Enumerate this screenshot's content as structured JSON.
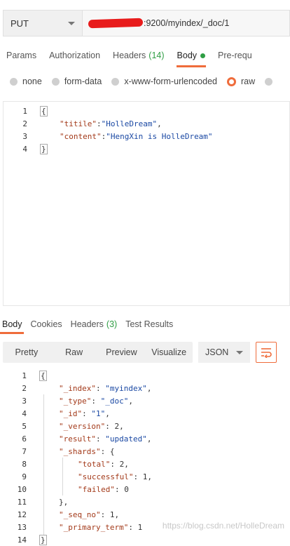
{
  "request": {
    "method": "PUT",
    "url_visible": ":9200/myindex/_doc/1"
  },
  "request_tabs": [
    {
      "label": "Params"
    },
    {
      "label": "Authorization"
    },
    {
      "label": "Headers",
      "count": "(14)"
    },
    {
      "label": "Body"
    },
    {
      "label": "Pre-requ"
    }
  ],
  "body_types": [
    {
      "label": "none"
    },
    {
      "label": "form-data"
    },
    {
      "label": "x-www-form-urlencoded"
    },
    {
      "label": "raw"
    }
  ],
  "request_body_lines": [
    {
      "n": "1"
    },
    {
      "n": "2",
      "key": "\"titile\"",
      "val": "\"HolleDream\""
    },
    {
      "n": "3",
      "key": "\"content\"",
      "val": "\"HengXin is HolleDream\""
    },
    {
      "n": "4"
    }
  ],
  "response_tabs": [
    {
      "label": "Body"
    },
    {
      "label": "Cookies"
    },
    {
      "label": "Headers",
      "count": "(3)"
    },
    {
      "label": "Test Results"
    }
  ],
  "view_modes": [
    "Pretty",
    "Raw",
    "Preview",
    "Visualize"
  ],
  "format": "JSON",
  "response_lines": [
    {
      "n": "1",
      "text": "{"
    },
    {
      "n": "2",
      "key": "\"_index\"",
      "val": "\"myindex\"",
      "tail": ","
    },
    {
      "n": "3",
      "key": "\"_type\"",
      "val": "\"_doc\"",
      "tail": ","
    },
    {
      "n": "4",
      "key": "\"_id\"",
      "val": "\"1\"",
      "tail": ","
    },
    {
      "n": "5",
      "key": "\"_version\"",
      "val": "2",
      "tail": ","
    },
    {
      "n": "6",
      "key": "\"result\"",
      "val": "\"updated\"",
      "tail": ","
    },
    {
      "n": "7",
      "key": "\"_shards\"",
      "val": "{",
      "tail": ""
    },
    {
      "n": "8",
      "key": "\"total\"",
      "val": "2",
      "tail": ","
    },
    {
      "n": "9",
      "key": "\"successful\"",
      "val": "1",
      "tail": ","
    },
    {
      "n": "10",
      "key": "\"failed\"",
      "val": "0",
      "tail": ""
    },
    {
      "n": "11",
      "text": "},"
    },
    {
      "n": "12",
      "key": "\"_seq_no\"",
      "val": "1",
      "tail": ","
    },
    {
      "n": "13",
      "key": "\"_primary_term\"",
      "val": "1",
      "tail": ""
    },
    {
      "n": "14",
      "text": "}"
    }
  ],
  "watermark": "https://blog.csdn.net/HolleDream"
}
